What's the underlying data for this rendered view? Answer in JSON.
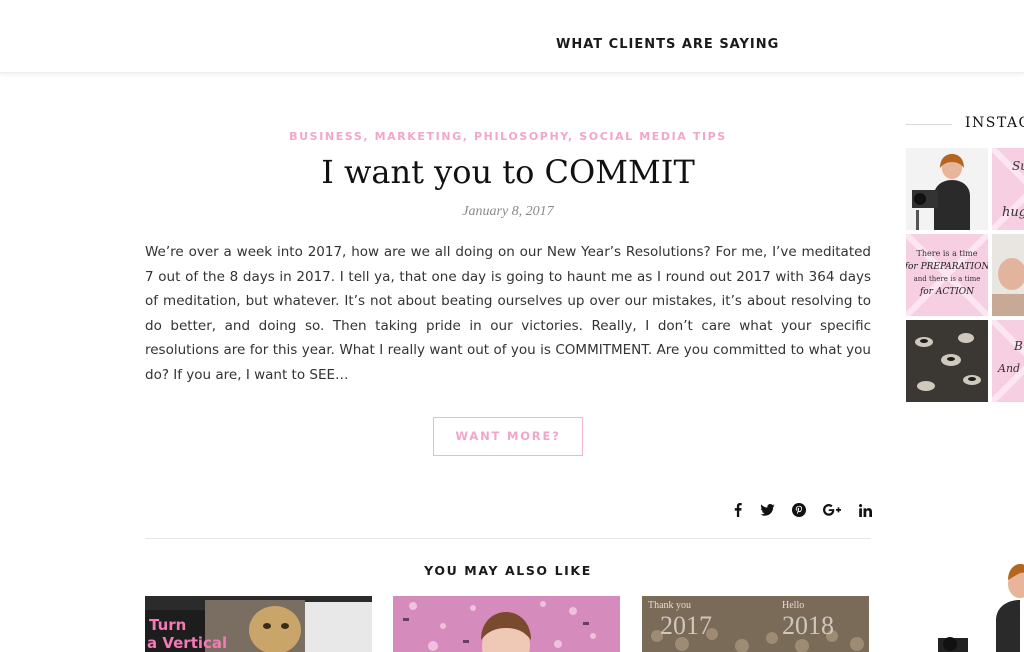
{
  "nav": {
    "item": "WHAT CLIENTS ARE SAYING"
  },
  "post": {
    "categories": [
      "BUSINESS",
      "MARKETING",
      "PHILOSOPHY",
      "SOCIAL MEDIA TIPS"
    ],
    "title": "I want you to COMMIT",
    "date": "January 8, 2017",
    "excerpt": "We’re over a week into 2017, how are we all doing on our New Year’s Resolutions? For me, I’ve meditated 7 out of the 8 days in 2017. I tell ya, that one day is going to haunt me as I round out 2017 with 364 days of meditation, but whatever. It’s not about beating ourselves up over our mistakes, it’s about resolving to do better, and doing so. Then taking pride in our victories. Really, I don’t care what your specific resolutions are for this year. What I really want out of you is COMMITMENT. Are you committed to what you do? If you are, I want to SEE…",
    "more_label": "WANT MORE?",
    "share_icons": [
      "facebook-icon",
      "twitter-icon",
      "pinterest-icon",
      "google-plus-icon",
      "linkedin-icon"
    ]
  },
  "related": {
    "heading": "YOU MAY ALSO LIKE",
    "items": [
      {
        "thumb_text": "Turn a Vertical Photo into"
      },
      {
        "thumb_text": ""
      },
      {
        "thumb_text_left": "Thank you",
        "thumb_text_right": "Hello",
        "year_left": "2017",
        "year_right": "2018"
      }
    ]
  },
  "sidebar": {
    "heading": "INSTAG",
    "tiles": [
      {
        "text": ""
      },
      {
        "text": "Su... hug"
      },
      {
        "text": "There is a time for PREPARATION and there is a time for ACTION"
      },
      {
        "text": ""
      },
      {
        "text": ""
      },
      {
        "text": "B... And"
      }
    ]
  },
  "colors": {
    "accent_pink": "#f3a6c8",
    "text": "#333333",
    "heading": "#111111"
  }
}
